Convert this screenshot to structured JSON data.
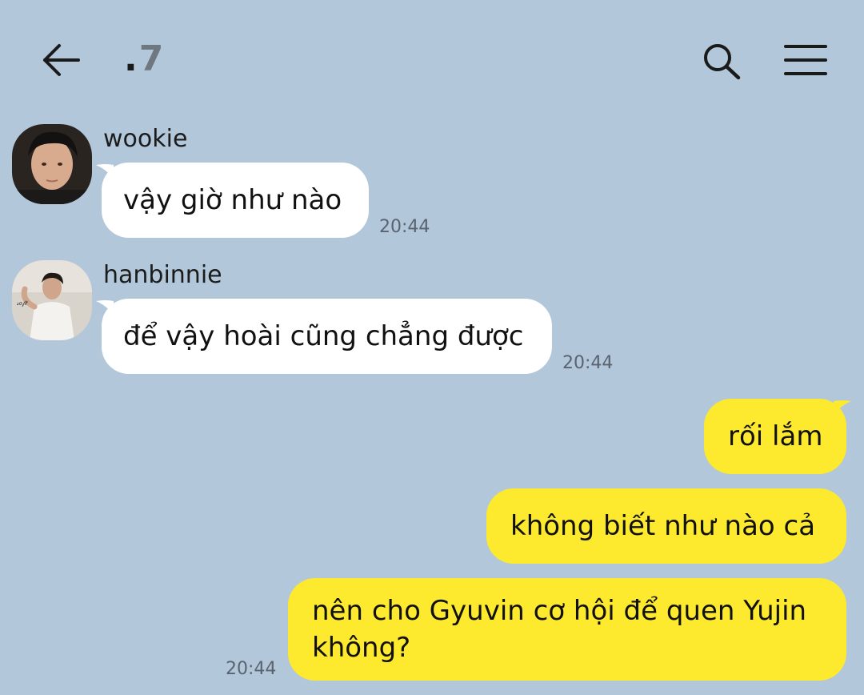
{
  "header": {
    "title_dot": ".",
    "title_text": "7",
    "back_icon": "arrow-left-icon",
    "search_icon": "search-icon",
    "menu_icon": "hamburger-menu-icon"
  },
  "colors": {
    "background": "#b2c7da",
    "incoming_bubble": "#ffffff",
    "outgoing_bubble": "#fde92e"
  },
  "messages": [
    {
      "sender": "wookie",
      "text": "vậy giờ như nào",
      "time": "20:44",
      "direction": "incoming"
    },
    {
      "sender": "hanbinnie",
      "text": "để vậy hoài cũng chẳng được",
      "time": "20:44",
      "direction": "incoming"
    },
    {
      "text": "rối lắm",
      "direction": "outgoing"
    },
    {
      "text": "không biết như nào cả",
      "direction": "outgoing"
    },
    {
      "text_line1": "nên cho Gyuvin cơ hội để quen Yujin",
      "text_line2": "không?",
      "time": "20:44",
      "direction": "outgoing"
    }
  ]
}
